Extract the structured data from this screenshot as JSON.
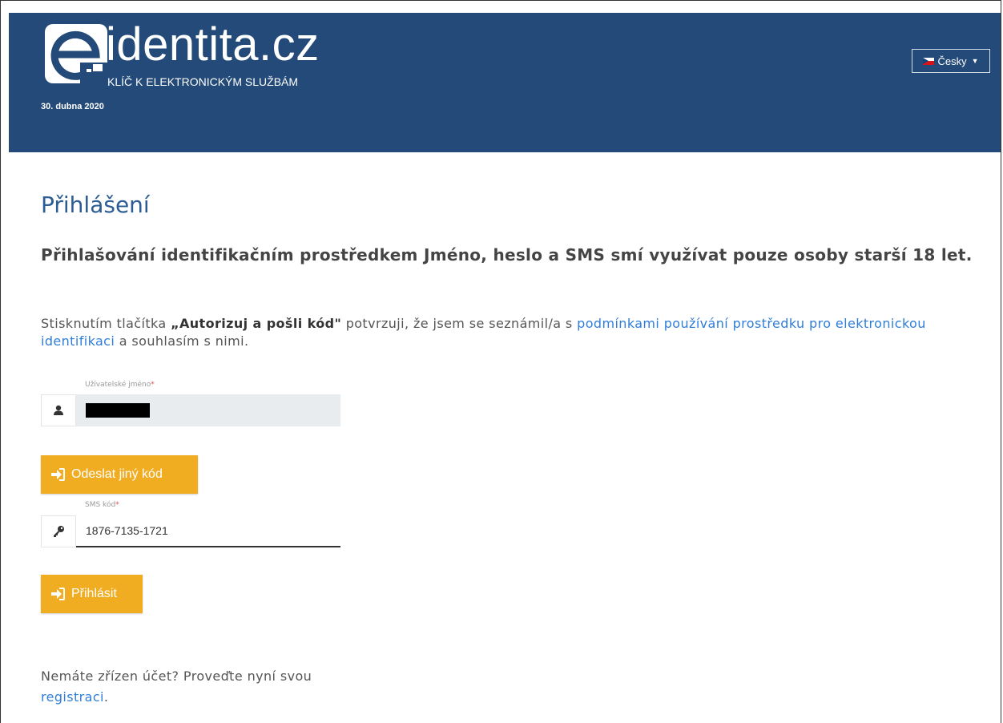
{
  "header": {
    "logo_text": "identita.cz",
    "tagline": "KLÍČ K ELEKTRONICKÝM SLUŽBÁM",
    "date": "30. dubna 2020",
    "language": "Česky",
    "background_color": "#234a78"
  },
  "main": {
    "title": "Přihlášení",
    "lead": "Přihlašování identifikačním prostředkem Jméno, heslo a SMS smí využívat pouze osoby starší 18 let.",
    "consent": {
      "prefix": "Stisknutím tlačítka ",
      "button_ref": "„Autorizuj a pošli kód\"",
      "middle": " potvrzuji, že jsem se seznámil/a s ",
      "link": "podmínkami používání prostředku pro elektronickou identifikaci",
      "suffix": " a souhlasím s nimi."
    },
    "username": {
      "label": "Uživatelské jméno",
      "required_mark": "*",
      "icon": "user-icon"
    },
    "resend_button": {
      "label": "Odeslat jiný kód",
      "icon": "sign-in-icon"
    },
    "sms": {
      "label": "SMS kód",
      "required_mark": "*",
      "value": "1876-7135-1721",
      "icon": "key-icon"
    },
    "login_button": {
      "label": "Přihlásit",
      "icon": "sign-in-icon"
    },
    "footer": {
      "text": "Nemáte zřízen účet? Proveďte nyní svou ",
      "link": "registraci",
      "suffix": "."
    }
  },
  "colors": {
    "accent": "#f0ad22",
    "title": "#2c5c94",
    "link": "#2f7ed8"
  }
}
